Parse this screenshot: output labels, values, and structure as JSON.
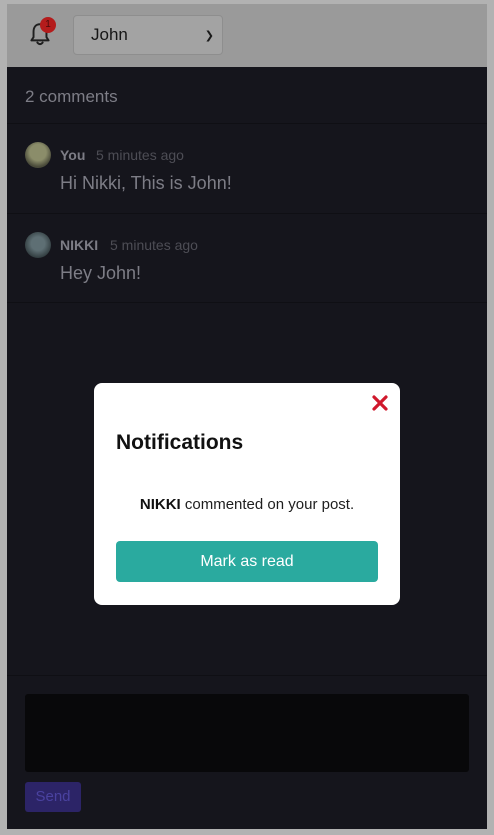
{
  "header": {
    "notification_count": "1",
    "user_select": {
      "selected": "John"
    }
  },
  "comments": {
    "count_label": "2 comments",
    "items": [
      {
        "author": "You",
        "time": "5 minutes ago",
        "text": "Hi Nikki, This is John!"
      },
      {
        "author": "NIKKI",
        "time": "5 minutes ago",
        "text": "Hey John!"
      }
    ]
  },
  "composer": {
    "send_label": "Send"
  },
  "modal": {
    "title": "Notifications",
    "notification": {
      "actor": "NIKKI",
      "message": "commented on your post."
    },
    "mark_read_label": "Mark as read"
  },
  "colors": {
    "accent_teal": "#2aaa9f",
    "close_red": "#d0182c",
    "send_purple": "#2c2467",
    "panel_dark": "#15151c"
  },
  "icons": {
    "bell": "bell-icon",
    "close": "close-icon",
    "dropdown": "chevron-down-icon"
  }
}
